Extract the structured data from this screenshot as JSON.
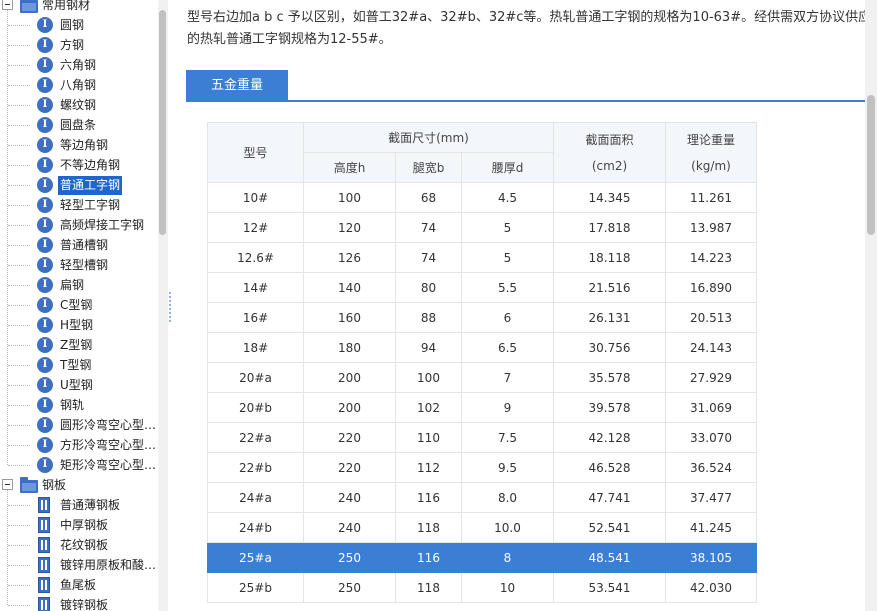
{
  "tree": {
    "groups": [
      {
        "label": "常用钢材",
        "icon": "folder-icon"
      },
      {
        "label": "钢板",
        "icon": "folder-icon"
      }
    ],
    "group1_items": [
      "圆钢",
      "方钢",
      "六角钢",
      "八角钢",
      "螺纹钢",
      "圆盘条",
      "等边角钢",
      "不等边角钢",
      "普通工字钢",
      "轻型工字钢",
      "高频焊接工字钢",
      "普通槽钢",
      "轻型槽钢",
      "扁钢",
      "C型钢",
      "H型钢",
      "Z型钢",
      "T型钢",
      "U型钢",
      "钢轨",
      "圆形冷弯空心型…",
      "方形冷弯空心型…",
      "矩形冷弯空心型…"
    ],
    "group2_items": [
      "普通薄钢板",
      "中厚钢板",
      "花纹钢板",
      "镀锌用原板和酸…",
      "鱼尾板",
      "镀锌钢板"
    ],
    "selected_item": "普通工字钢",
    "item_icon_glyph": "I"
  },
  "content": {
    "para_line1": "型号右边加a b c 予以区别，如普工32#a、32#b、32#c等。热轧普通工字钢的规格为10-63#。经供需双方协议供应",
    "para_line2": "的热轧普通工字钢规格为12-55#。",
    "tab_label": "五金重量",
    "table": {
      "headers": {
        "model": "型号",
        "section": "截面尺寸(mm)",
        "height": "高度h",
        "leg_width": "腿宽b",
        "waist_thickness": "腰厚d",
        "area_top": "截面面积",
        "area_unit": "(cm2)",
        "weight_top": "理论重量",
        "weight_unit": "(kg/m)"
      },
      "rows": [
        [
          "10#",
          "100",
          "68",
          "4.5",
          "14.345",
          "11.261"
        ],
        [
          "12#",
          "120",
          "74",
          "5",
          "17.818",
          "13.987"
        ],
        [
          "12.6#",
          "126",
          "74",
          "5",
          "18.118",
          "14.223"
        ],
        [
          "14#",
          "140",
          "80",
          "5.5",
          "21.516",
          "16.890"
        ],
        [
          "16#",
          "160",
          "88",
          "6",
          "26.131",
          "20.513"
        ],
        [
          "18#",
          "180",
          "94",
          "6.5",
          "30.756",
          "24.143"
        ],
        [
          "20#a",
          "200",
          "100",
          "7",
          "35.578",
          "27.929"
        ],
        [
          "20#b",
          "200",
          "102",
          "9",
          "39.578",
          "31.069"
        ],
        [
          "22#a",
          "220",
          "110",
          "7.5",
          "42.128",
          "33.070"
        ],
        [
          "22#b",
          "220",
          "112",
          "9.5",
          "46.528",
          "36.524"
        ],
        [
          "24#a",
          "240",
          "116",
          "8.0",
          "47.741",
          "37.477"
        ],
        [
          "24#b",
          "240",
          "118",
          "10.0",
          "52.541",
          "41.245"
        ],
        [
          "25#a",
          "250",
          "116",
          "8",
          "48.541",
          "38.105"
        ],
        [
          "25#b",
          "250",
          "118",
          "10",
          "53.541",
          "42.030"
        ]
      ],
      "selected_row": "25#a"
    }
  },
  "colors": {
    "accent": "#3a7fd4",
    "tree_selected": "#1f66cc",
    "icon_blue": "#3f6fbf"
  }
}
